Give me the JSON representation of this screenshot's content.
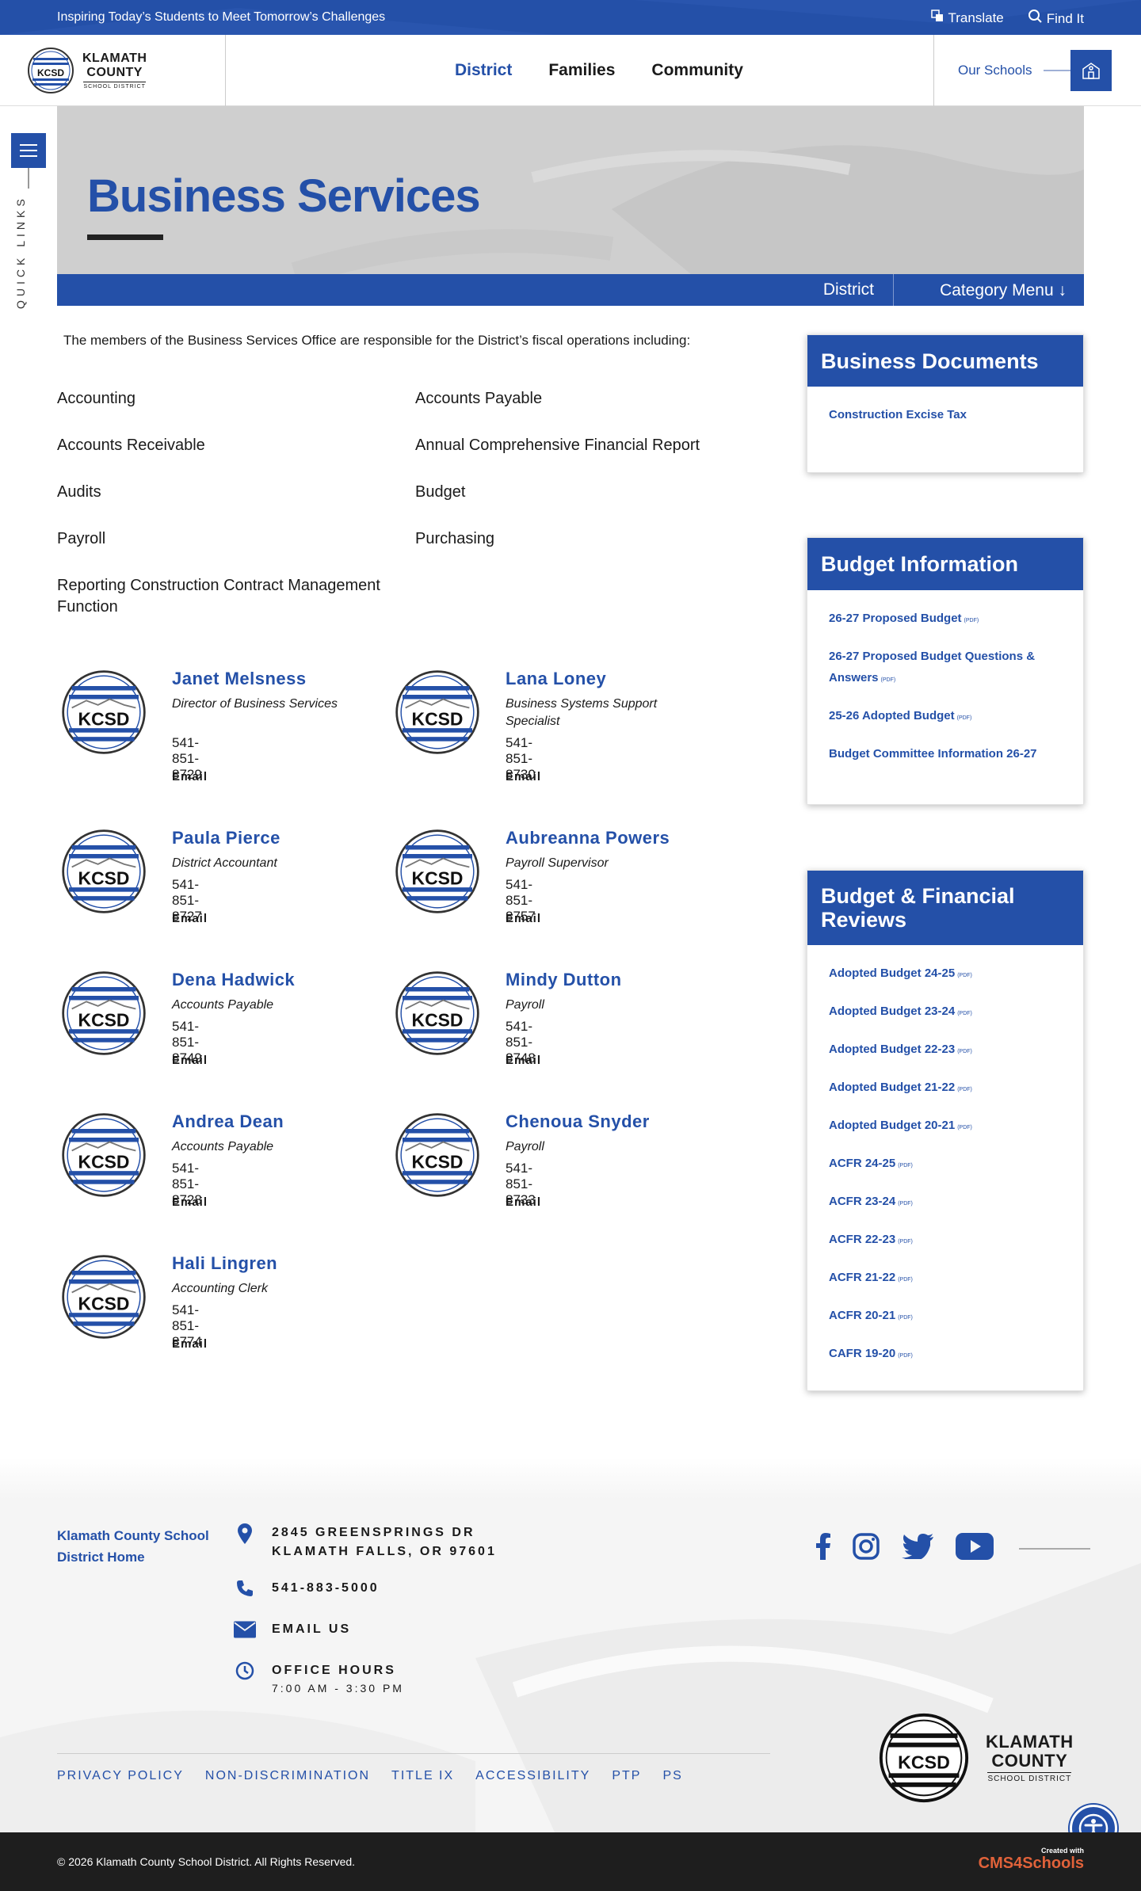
{
  "topbar": {
    "tagline": "Inspiring Today’s Students to Meet Tomorrow’s Challenges",
    "translate": "Translate",
    "find_it": "Find It"
  },
  "header": {
    "logo": {
      "line1": "KLAMATH",
      "line2": "COUNTY",
      "line3": "SCHOOL DISTRICT",
      "badge": "KCSD"
    },
    "nav": [
      "District",
      "Families",
      "Community"
    ],
    "our_schools": "Our Schools"
  },
  "quick_links": "QUICK LINKS",
  "hero": {
    "title": "Business Services"
  },
  "category_bar": {
    "district": "District",
    "category_menu": "Category Menu",
    "arrow": "↓"
  },
  "intro": "The members of the Business Services Office are responsible for the District’s fiscal operations including:",
  "areas": [
    "Accounting",
    "Accounts Payable",
    "Accounts Receivable",
    "Annual Comprehensive Financial Report",
    "Audits",
    "Budget",
    "Payroll",
    "Purchasing",
    "Reporting Construction Contract Management Function"
  ],
  "staff": [
    {
      "name": "Janet Melsness",
      "title": "Director of Business Services",
      "phone": "541-851-8729",
      "email": "Email"
    },
    {
      "name": "Lana Loney",
      "title": "Business Systems Support Specialist",
      "phone": "541-851-8730",
      "email": "Email"
    },
    {
      "name": "Paula Pierce",
      "title": "District Accountant",
      "phone": "541-851-8727",
      "email": "Email"
    },
    {
      "name": "Aubreanna Powers",
      "title": "Payroll Supervisor",
      "phone": "541-851-8757",
      "email": "Email"
    },
    {
      "name": "Dena Hadwick",
      "title": "Accounts Payable",
      "phone": "541-851-8749",
      "email": "Email"
    },
    {
      "name": "Mindy Dutton",
      "title": "Payroll",
      "phone": "541-851-8748",
      "email": "Email"
    },
    {
      "name": "Andrea Dean",
      "title": "Accounts Payable",
      "phone": "541-851-8728",
      "email": "Email"
    },
    {
      "name": "Chenoua Snyder",
      "title": "Payroll",
      "phone": "541-851-8733",
      "email": "Email"
    },
    {
      "name": "Hali Lingren",
      "title": "Accounting Clerk",
      "phone": "541-851-8774",
      "email": "Email"
    }
  ],
  "sidebar": {
    "business_documents": {
      "title": "Business Documents",
      "links": [
        {
          "label": "Construction Excise Tax",
          "tag": ""
        }
      ]
    },
    "budget_information": {
      "title": "Budget Information",
      "links": [
        {
          "label": "26-27 Proposed Budget",
          "tag": "(PDF)"
        },
        {
          "label": "26-27 Proposed Budget Questions & Answers",
          "tag": "(PDF)"
        },
        {
          "label": "25-26 Adopted Budget",
          "tag": "(PDF)"
        },
        {
          "label": "Budget Committee Information 26-27",
          "tag": ""
        }
      ]
    },
    "financial_reviews": {
      "title": "Budget & Financial Reviews",
      "links": [
        {
          "label": "Adopted Budget 24-25",
          "tag": "(PDF)"
        },
        {
          "label": "Adopted Budget 23-24",
          "tag": "(PDF)"
        },
        {
          "label": "Adopted Budget 22-23",
          "tag": "(PDF)"
        },
        {
          "label": "Adopted Budget 21-22",
          "tag": "(PDF)"
        },
        {
          "label": "Adopted Budget 20-21",
          "tag": "(PDF)"
        },
        {
          "label": "ACFR 24-25",
          "tag": "(PDF)"
        },
        {
          "label": "ACFR 23-24",
          "tag": "(PDF)"
        },
        {
          "label": "ACFR 22-23",
          "tag": "(PDF)"
        },
        {
          "label": "ACFR 21-22",
          "tag": "(PDF)"
        },
        {
          "label": "ACFR 20-21",
          "tag": "(PDF)"
        },
        {
          "label": "CAFR 19-20",
          "tag": "(PDF)"
        }
      ]
    }
  },
  "footer": {
    "logo_alt": "Klamath County School District Home",
    "address1": "2845 GREENSPRINGS DR",
    "address2": "KLAMATH FALLS, OR 97601",
    "phone": "541-883-5000",
    "email": "EMAIL US",
    "hours_label": "OFFICE HOURS",
    "hours": "7:00 AM - 3:30 PM",
    "social": [
      "facebook-icon",
      "instagram-icon",
      "twitter-icon",
      "youtube-icon"
    ],
    "links": [
      "PRIVACY POLICY",
      "NON-DISCRIMINATION",
      "TITLE IX",
      "ACCESSIBILITY",
      "PTP",
      "PS"
    ],
    "logo": {
      "line1": "KLAMATH",
      "line2": "COUNTY",
      "line3": "SCHOOL DISTRICT",
      "badge": "KCSD"
    }
  },
  "copyright": "© 2026 Klamath County School District. All Rights Reserved.",
  "credit": {
    "line1": "Created with",
    "line2": "CMS4Schools"
  },
  "colors": {
    "brand": "#2450a8",
    "dark": "#1e1e1e",
    "hero_bg": "#cfcfcf"
  }
}
